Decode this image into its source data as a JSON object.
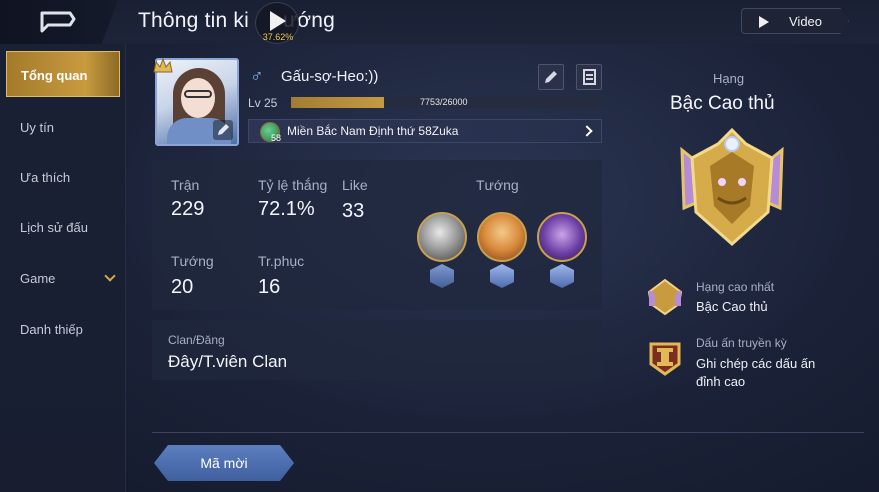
{
  "header": {
    "title": "Thông tin ki",
    "title_tail": "ướng",
    "record_percent": "37.62%",
    "video_label": "Video"
  },
  "sidebar": {
    "items": [
      {
        "label": "Tổng quan",
        "active": true
      },
      {
        "label": "Uy tín"
      },
      {
        "label": "Ưa thích"
      },
      {
        "label": "Lịch sử đấu"
      },
      {
        "label": "Game",
        "expandable": true
      },
      {
        "label": "Danh thiếp"
      }
    ]
  },
  "profile": {
    "gender_icon": "male-icon",
    "name": "Gấu-sợ-Heo:))",
    "level": "Lv 25",
    "xp_text": "7753/26000",
    "xp_fraction": 0.298,
    "location": "Miền Bắc Nam Định thứ 58Zuka",
    "location_badge": "58"
  },
  "stats": {
    "matches_label": "Trận",
    "matches_value": "229",
    "winrate_label": "Tỷ lệ thắng",
    "winrate_value": "72.1%",
    "like_label": "Like",
    "like_value": "33",
    "heroes_label": "Tướng",
    "heroes_value": "20",
    "skins_label": "Tr.phục",
    "skins_value": "16",
    "top_heroes_label": "Tướng"
  },
  "clan": {
    "label": "Clan/Đăng",
    "value": "Đây/T.viên Clan"
  },
  "invite_label": "Mã mời",
  "rank": {
    "title": "Hạng",
    "name": "Bậc Cao thủ",
    "highest_label": "Hạng cao nhất",
    "highest_value": "Bậc Cao thủ",
    "legend_label": "Dấu ấn truyền kỳ",
    "legend_value_line1": "Ghi chép các dấu ấn",
    "legend_value_line2": "đỉnh cao"
  },
  "colors": {
    "accent_gold": "#c99b3f",
    "xp_fill": "#b08a3c",
    "invite_blue": "#4d6fb0"
  }
}
